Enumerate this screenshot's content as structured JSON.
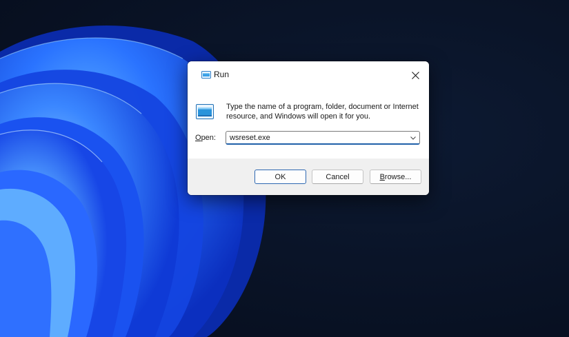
{
  "dialog": {
    "title": "Run",
    "instruction": "Type the name of a program, folder, document or Internet resource, and Windows will open it for you.",
    "open_label_underlined": "O",
    "open_label_rest": "pen:",
    "open_value": "wsreset.exe",
    "buttons": {
      "ok": "OK",
      "cancel": "Cancel",
      "browse_underlined": "B",
      "browse_rest": "rowse..."
    }
  },
  "icons": {
    "title": "run-icon",
    "body": "run-icon",
    "close": "close-icon",
    "combo": "chevron-down-icon"
  },
  "colors": {
    "wallpaper_dark": "#060d1c",
    "bloom_blue": "#1f5cff",
    "focus_accent": "#1f5fa8",
    "footer_bg": "#f0f0f0"
  }
}
